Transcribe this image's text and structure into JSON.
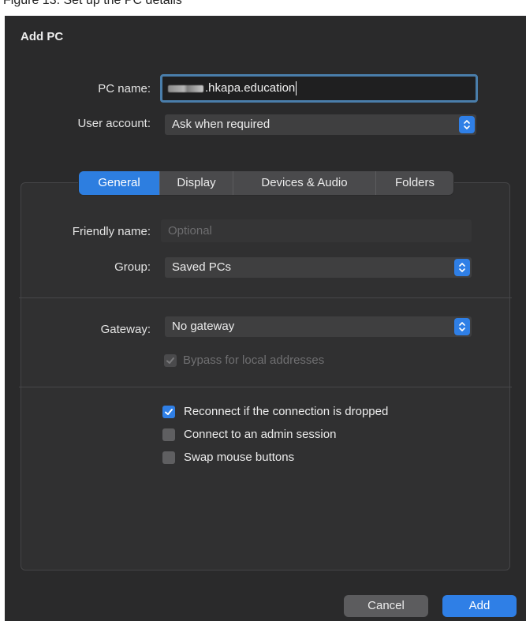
{
  "caption_fragment": "Figure 13. Set up the PC details",
  "dialog": {
    "title": "Add PC",
    "pc_name": {
      "label": "PC name:",
      "value_suffix": ".hkapa.education"
    },
    "user_account": {
      "label": "User account:",
      "value": "Ask when required"
    },
    "tabs": [
      {
        "label": "General",
        "active": true
      },
      {
        "label": "Display",
        "active": false
      },
      {
        "label": "Devices & Audio",
        "active": false
      },
      {
        "label": "Folders",
        "active": false
      }
    ],
    "general": {
      "friendly_name": {
        "label": "Friendly name:",
        "placeholder": "Optional",
        "value": ""
      },
      "group": {
        "label": "Group:",
        "value": "Saved PCs"
      },
      "gateway": {
        "label": "Gateway:",
        "value": "No gateway"
      },
      "bypass": {
        "label": "Bypass for local addresses",
        "checked": true,
        "enabled": false
      },
      "reconnect": {
        "label": "Reconnect if the connection is dropped",
        "checked": true
      },
      "admin_session": {
        "label": "Connect to an admin session",
        "checked": false
      },
      "swap_mouse": {
        "label": "Swap mouse buttons",
        "checked": false
      }
    },
    "buttons": {
      "cancel": "Cancel",
      "add": "Add"
    },
    "colors": {
      "accent": "#2f7fe6",
      "background": "#2a2a2b",
      "panel": "#303031"
    }
  }
}
